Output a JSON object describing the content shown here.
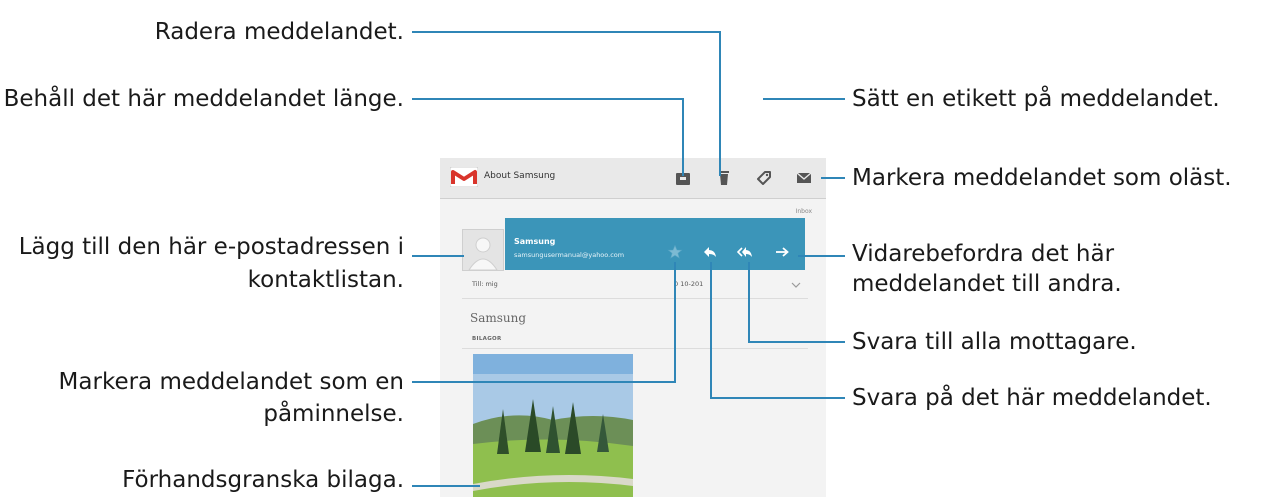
{
  "app": {
    "title": "About Samsung",
    "folder_label": "Inbox",
    "sender_name": "Samsung",
    "sender_email": "samsungusermanual@yahoo.com",
    "to_line": "Till: mig",
    "date_text": "0    10-201",
    "subject": "Samsung",
    "attachments_label": "BILAGOR"
  },
  "icons": {
    "logo": "gmail-logo",
    "archive": "archive-icon",
    "delete": "trash-icon",
    "label": "label-tag-icon",
    "unread": "envelope-icon",
    "reminder": "star-icon",
    "reply": "reply-icon",
    "reply_all": "reply-all-icon",
    "forward": "forward-icon"
  },
  "colors": {
    "header_band": "#3b95b9",
    "callout_line": "#2f86b7"
  },
  "callouts": {
    "delete": "Radera meddelandet.",
    "archive": "Behåll det här meddelandet länge.",
    "label": "Sätt en etikett på meddelandet.",
    "unread": "Markera meddelandet som oläst.",
    "add_contact_1": "Lägg till den här e-postadressen i",
    "add_contact_2": "kontaktlistan.",
    "forward_1": "Vidarebefordra det här",
    "forward_2": "meddelandet till andra.",
    "reply_all": "Svara till alla mottagare.",
    "reminder_1": "Markera meddelandet som en",
    "reminder_2": "påminnelse.",
    "reply": "Svara på det här meddelandet.",
    "preview": "Förhandsgranska bilaga."
  }
}
